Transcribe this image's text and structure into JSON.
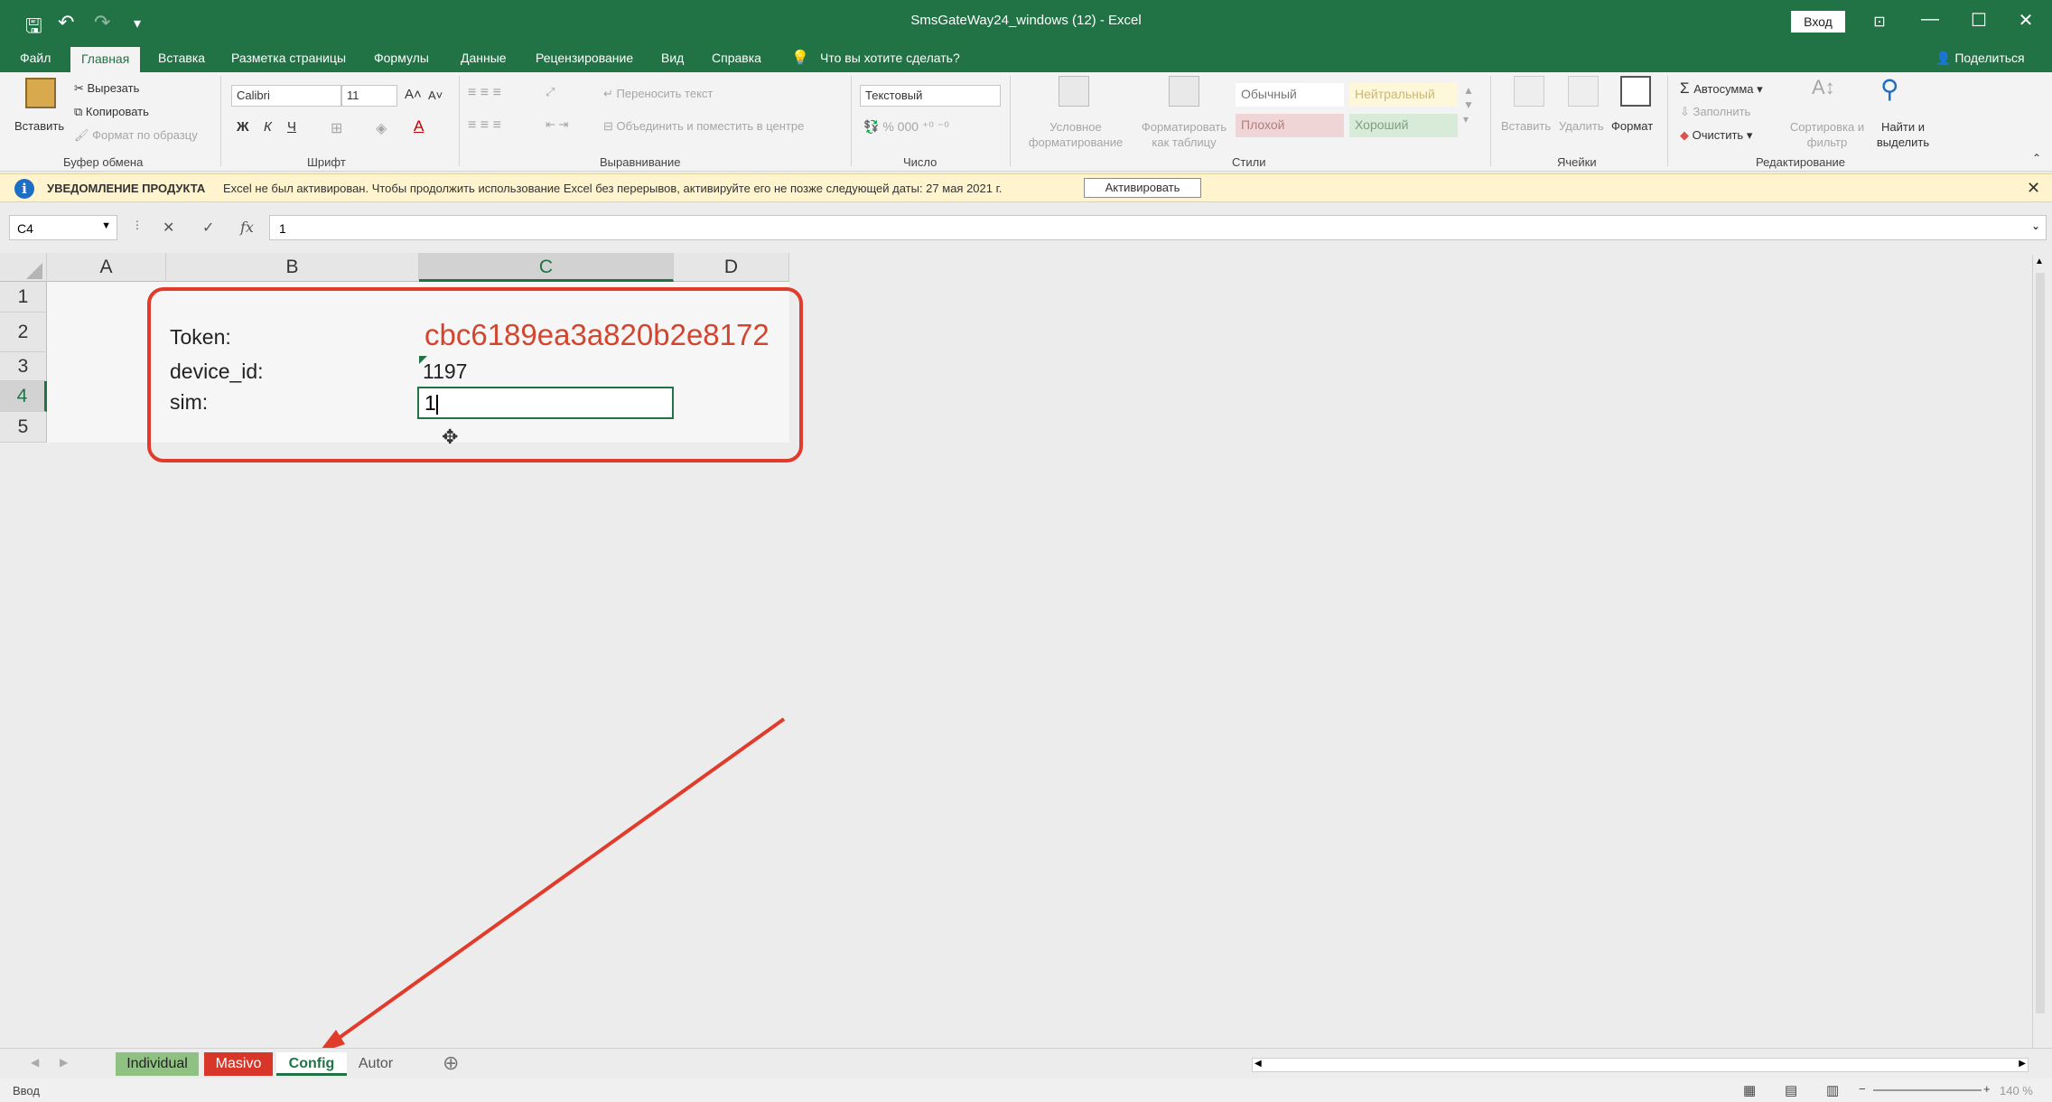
{
  "titlebar": {
    "title": "SmsGateWay24_windows (12) - Excel",
    "signin": "Вход"
  },
  "menu": [
    "Файл",
    "Главная",
    "Вставка",
    "Разметка страницы",
    "Формулы",
    "Данные",
    "Рецензирование",
    "Вид",
    "Справка",
    "Что вы хотите сделать?"
  ],
  "share": "Поделиться",
  "ribbon": {
    "clipboard": {
      "paste": "Вставить",
      "cut": "Вырезать",
      "copy": "Копировать",
      "format_painter": "Формат по образцу",
      "group": "Буфер обмена"
    },
    "font": {
      "name": "Calibri",
      "size": "11",
      "bold": "Ж",
      "italic": "К",
      "underline": "Ч",
      "group": "Шрифт"
    },
    "alignment": {
      "wrap": "Переносить текст",
      "merge": "Объединить и поместить в центре",
      "group": "Выравнивание"
    },
    "number": {
      "format": "Текстовый",
      "group": "Число"
    },
    "styles": {
      "cond": "Условное форматирование",
      "table": "Форматировать как таблицу",
      "normal": "Обычный",
      "neutral": "Нейтральный",
      "bad": "Плохой",
      "good": "Хороший",
      "group": "Стили"
    },
    "cells": {
      "insert": "Вставить",
      "delete": "Удалить",
      "format": "Формат",
      "group": "Ячейки"
    },
    "editing": {
      "autosum": "Автосумма",
      "fill": "Заполнить",
      "clear": "Очистить",
      "sort": "Сортировка и фильтр",
      "find": "Найти и выделить",
      "group": "Редактирование"
    }
  },
  "notify": {
    "title": "УВЕДОМЛЕНИЕ ПРОДУКТА",
    "message": "Excel не был активирован. Чтобы продолжить использование Excel без перерывов, активируйте его не позже следующей даты: 27 мая 2021 г.",
    "button": "Активировать"
  },
  "formula": {
    "namebox": "C4",
    "value": "1"
  },
  "columns": [
    "A",
    "B",
    "C",
    "D"
  ],
  "rows": [
    "1",
    "2",
    "3",
    "4",
    "5"
  ],
  "cells": {
    "b2": "Token:",
    "c2": "cbc6189ea3a820b2e8172",
    "b3": "device_id:",
    "c3": "1197",
    "b4": "sim:",
    "c4": "1"
  },
  "sheets": [
    "Individual",
    "Masivo",
    "Config",
    "Autor"
  ],
  "status": "Ввод",
  "zoom": "140 %",
  "colors": {
    "excel_green": "#217346",
    "token": "#d2452e",
    "annotation": "#e03b2b"
  }
}
